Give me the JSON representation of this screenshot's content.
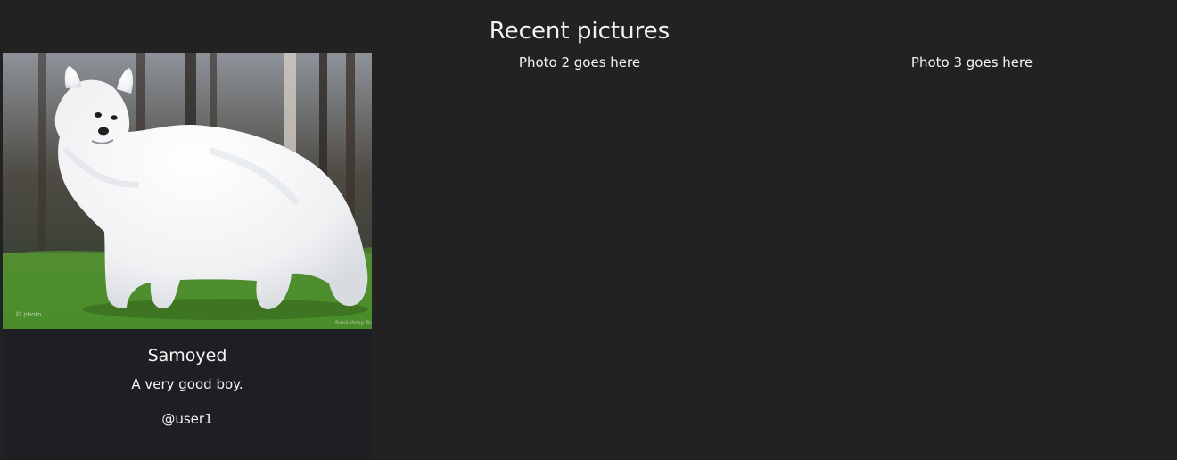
{
  "header": {
    "title": "Recent pictures"
  },
  "cards": [
    {
      "image_subject": "white samoyed dog standing on grass",
      "title": "Samoyed",
      "description": "A very good boy.",
      "user": "@user1"
    }
  ],
  "placeholders": [
    "Photo 2 goes here",
    "Photo 3 goes here"
  ],
  "colors": {
    "background": "#222222",
    "card_background": "#1e1f23",
    "text": "#f2f2f2",
    "divider": "#5f5f5f"
  }
}
